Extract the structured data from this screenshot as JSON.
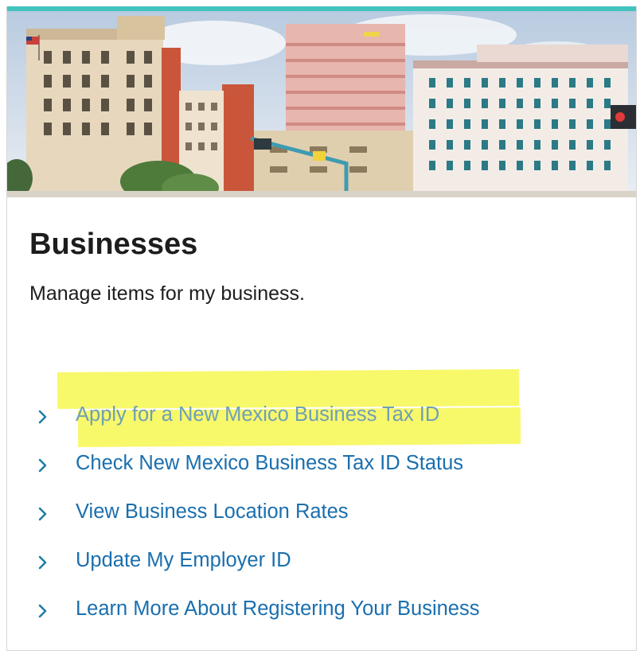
{
  "colors": {
    "accent_bar": "#43c3bd",
    "heading": "#1d1d1d",
    "link": "#1a6fae",
    "link_highlighted": "#6fa0b4",
    "chevron": "#1f7fa6",
    "highlight": "#f7f74a"
  },
  "banner": {
    "description_icon": "city-skyline-image"
  },
  "section": {
    "title": "Businesses",
    "subtitle": "Manage items for my business."
  },
  "links": [
    {
      "label": "Apply for a New Mexico Business Tax ID",
      "highlighted": true
    },
    {
      "label": "Check New Mexico Business Tax ID Status",
      "highlighted": false
    },
    {
      "label": "View Business Location Rates",
      "highlighted": false
    },
    {
      "label": "Update My Employer ID",
      "highlighted": false
    },
    {
      "label": "Learn More About Registering Your Business",
      "highlighted": false
    }
  ]
}
